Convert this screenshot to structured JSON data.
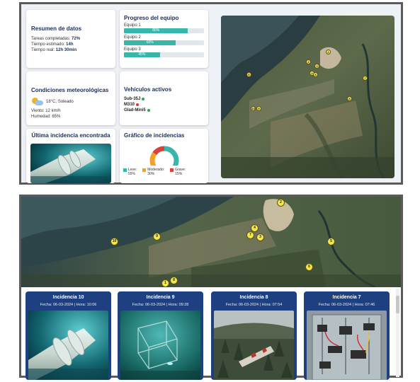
{
  "summary": {
    "title": "Resumen de datos",
    "tasks_label": "Tareas completadas:",
    "tasks_value": "72%",
    "est_label": "Tiempo estimado:",
    "est_value": "14h",
    "real_label": "Tiempo real:",
    "real_value": "12h 30min"
  },
  "progress": {
    "title": "Progreso del equipo",
    "teams": [
      {
        "label": "Equipo 1",
        "pct": "80%",
        "value": 0.8
      },
      {
        "label": "Equipo 2",
        "pct": "65%",
        "value": 0.65
      },
      {
        "label": "Equipo 3",
        "pct": "45%",
        "value": 0.45
      }
    ]
  },
  "weather": {
    "title": "Condiciones meteorológicas",
    "temp": "18°C, Soleado",
    "wind": "Viento: 12 km/h",
    "humidity": "Humedad: 65%",
    "icon": "partly-sunny-icon"
  },
  "vehicles": {
    "title": "Vehículos activos",
    "items": [
      {
        "name": "Sub-35J",
        "status_color": "#2da44e"
      },
      {
        "name": "M310",
        "status_color": "#d93a2b"
      },
      {
        "name": "Glad-Mini5",
        "status_color": "#2da44e"
      }
    ]
  },
  "last_incident": {
    "title": "Última incidencia encontrada",
    "image": "underwater-pipe-photo"
  },
  "incident_chart": {
    "title": "Gráfico de incidencias",
    "legend": [
      {
        "label": "Leve:",
        "pct": "55%",
        "color": "#39b6ab"
      },
      {
        "label": "Moderado:",
        "pct": "30%",
        "color": "#f3a12a"
      },
      {
        "label": "Grave:",
        "pct": "15%",
        "color": "#d9443a"
      }
    ]
  },
  "chart_data": {
    "type": "pie",
    "categories": [
      "Leve",
      "Moderado",
      "Grave"
    ],
    "values": [
      55,
      30,
      15
    ],
    "title": "Gráfico de incidencias"
  },
  "map_top": {
    "markers": [
      "1",
      "2",
      "3",
      "4",
      "5",
      "6",
      "7",
      "8",
      "9",
      "10"
    ]
  },
  "map_bottom": {
    "markers": [
      "1",
      "2",
      "3",
      "4",
      "5",
      "6",
      "7",
      "8",
      "9",
      "10"
    ]
  },
  "incidents": [
    {
      "title": "Incidencia 10",
      "meta": "Fecha: 06-03-2024 | Hora: 10:06",
      "image": "underwater-pipe-photo"
    },
    {
      "title": "Incidencia 9",
      "meta": "Fecha: 06-03-2024 | Hora: 09:28",
      "image": "underwater-structure-photo"
    },
    {
      "title": "Incidencia 8",
      "meta": "Fecha: 06-03-2024 | Hora: 07:54",
      "image": "forest-aerial-photo"
    },
    {
      "title": "Incidencia 7",
      "meta": "Fecha: 06-03-2024 | Hora: 07:46",
      "image": "electrical-panel-photo"
    }
  ],
  "colors": {
    "accent": "#39b6ab",
    "navy": "#1e3f80",
    "marker": "#f3e74a"
  }
}
